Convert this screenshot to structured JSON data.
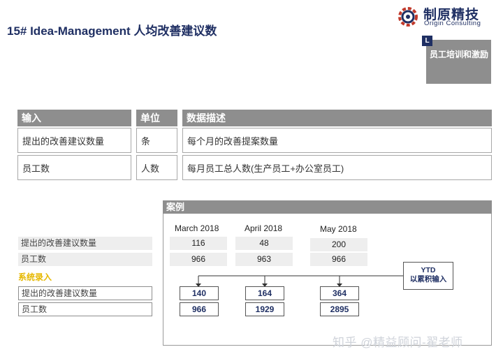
{
  "title": "15# Idea-Management 人均改善建议数",
  "logo": {
    "cn": "制原精技",
    "en": "Origin Consulting"
  },
  "tag": {
    "letter": "L",
    "text": "员工培训和激励"
  },
  "input_table": {
    "headers": [
      "输入",
      "单位",
      "数据描述"
    ],
    "rows": [
      [
        "提出的改善建议数量",
        "条",
        "每个月的改善提案数量"
      ],
      [
        "员工数",
        "人数",
        "每月员工总人数(生产员工+办公室员工)"
      ]
    ]
  },
  "case": {
    "header": "案例",
    "months": [
      "March 2018",
      "April 2018",
      "May 2018"
    ],
    "raw_rows": [
      {
        "label": "提出的改善建议数量",
        "values": [
          "116",
          "48",
          "200"
        ]
      },
      {
        "label": "员工数",
        "values": [
          "966",
          "963",
          "966"
        ]
      }
    ],
    "system_label": "系统录入",
    "cumulative_rows": [
      {
        "label": "提出的改善建议数量",
        "values": [
          "140",
          "164",
          "364"
        ]
      },
      {
        "label": "员工数",
        "values": [
          "966",
          "1929",
          "2895"
        ]
      }
    ],
    "ytd": {
      "line1": "YTD",
      "line2": "以累积输入"
    }
  },
  "watermark": "知乎 @精益顾问-翟老师",
  "colors": {
    "navy": "#1f2f63",
    "grey_header": "#8e8e8e",
    "light_grey": "#eeeeee",
    "accent_yellow": "#e6b800"
  }
}
